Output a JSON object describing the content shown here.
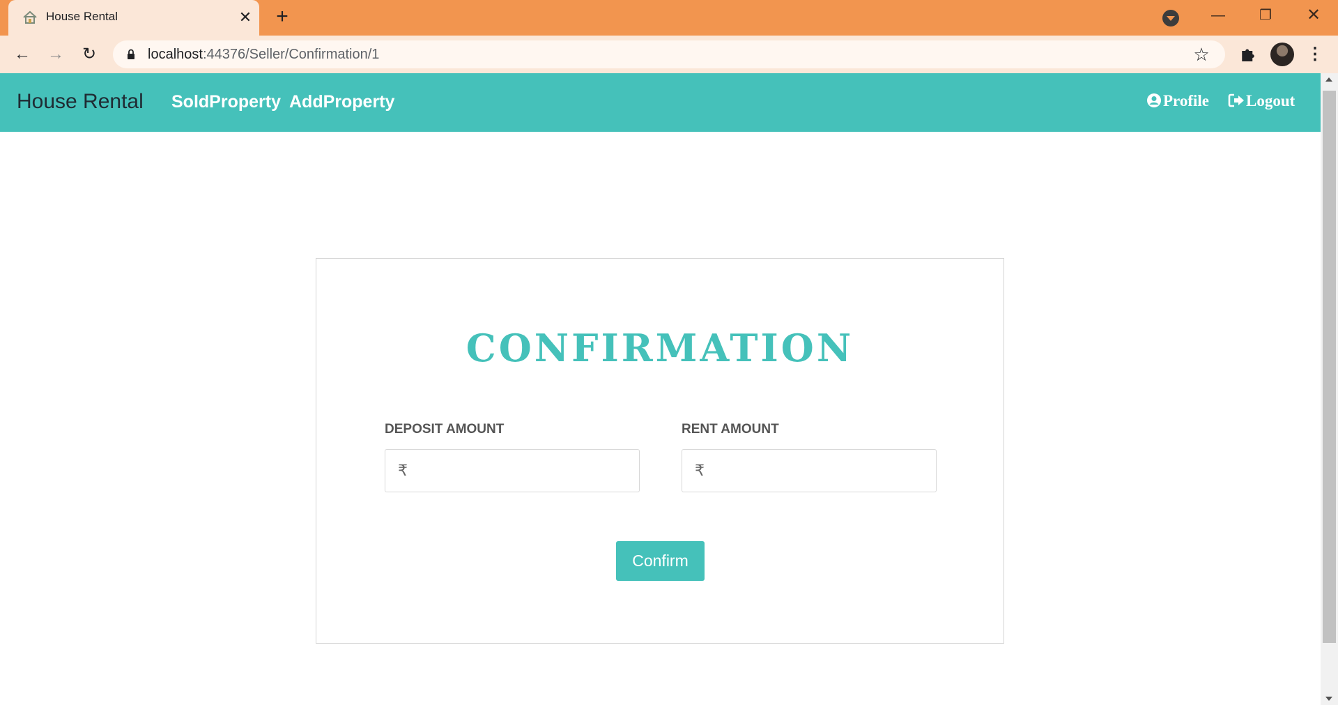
{
  "browser": {
    "tab_title": "House Rental",
    "tab_close_icon": "close-icon",
    "new_tab_icon": "plus-icon",
    "url_host": "localhost",
    "url_rest": ":44376/Seller/Confirmation/1",
    "icons": {
      "back": "arrow-left-icon",
      "forward": "arrow-right-icon",
      "reload": "reload-icon",
      "lock": "lock-icon",
      "bookmark": "star-icon",
      "extensions": "puzzle-icon",
      "menu": "kebab-menu-icon"
    },
    "window_controls": {
      "minimize": "—",
      "maximize": "❐",
      "close": "✕"
    }
  },
  "navbar": {
    "brand": "House Rental",
    "links": [
      "SoldProperty",
      "AddProperty"
    ],
    "profile": "Profile",
    "logout": "Logout",
    "accent_color": "#45c1ba"
  },
  "form": {
    "title": "CONFIRMATION",
    "deposit_label": "DEPOSIT AMOUNT",
    "rent_label": "RENT AMOUNT",
    "currency_symbol": "₹",
    "deposit_value": "",
    "rent_value": "",
    "confirm_label": "Confirm"
  }
}
